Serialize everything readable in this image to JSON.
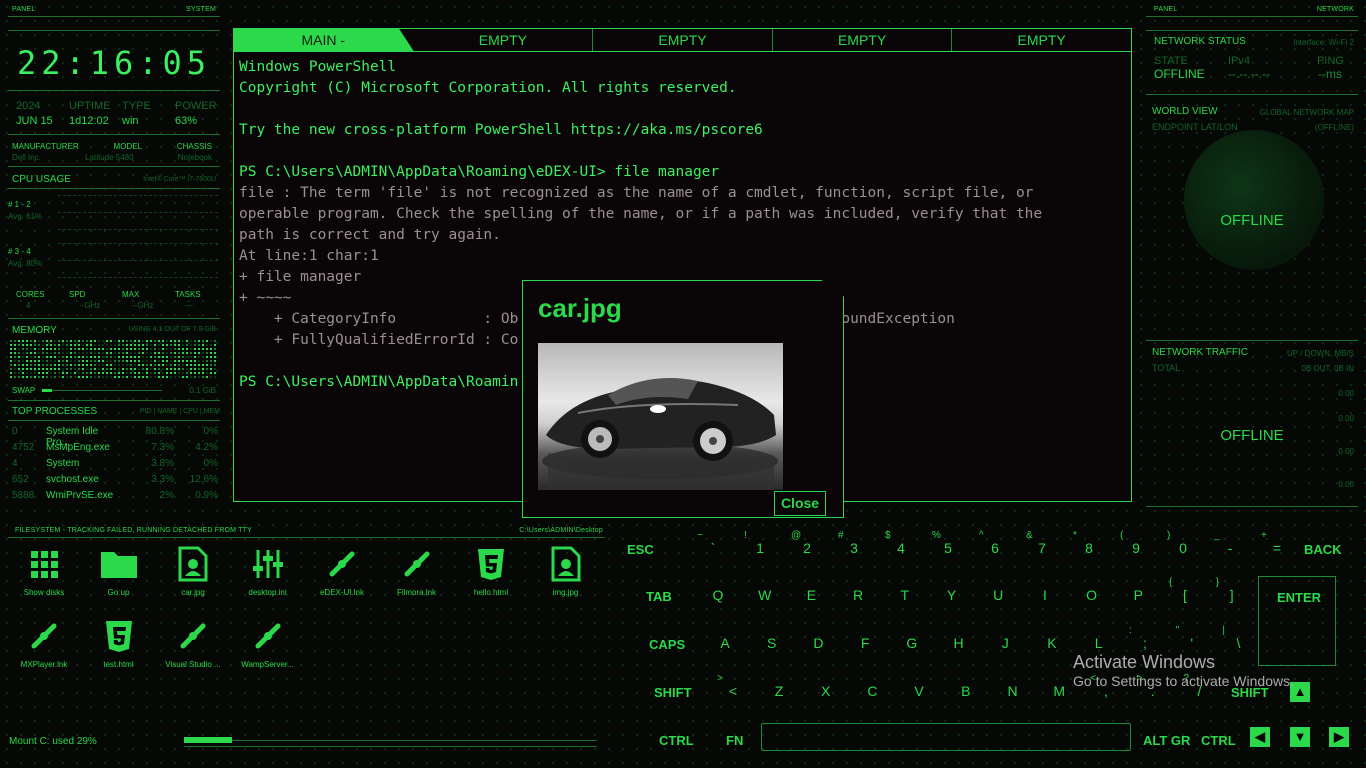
{
  "left_panel": {
    "header_left": "PANEL",
    "header_right": "SYSTEM",
    "clock": "22:16:05",
    "sys_labels": [
      "2024",
      "UPTIME",
      "TYPE",
      "POWER"
    ],
    "sys_values": [
      "JUN 15",
      "1d12:02",
      "win",
      "63%"
    ],
    "hw_labels": [
      "MANUFACTURER",
      "MODEL",
      "CHASSIS"
    ],
    "hw_values": [
      "Dell Inc.",
      "Latitude 5480",
      "Notebook"
    ],
    "cpu_title": "CPU USAGE",
    "cpu_model": "Intel® Core™ i7-7600U",
    "cpu_group1": "# 1 - 2",
    "cpu_group1_avg": "Avg. 61%",
    "cpu_group2": "# 3 - 4",
    "cpu_group2_avg": "Avg. 80%",
    "stat_labels": [
      "CORES",
      "SPD",
      "MAX",
      "TASKS"
    ],
    "stat_values": [
      "4",
      "--GHz",
      "--GHz",
      "---"
    ],
    "memory_title": "MEMORY",
    "memory_info": "USING 4.1 OUT OF 7.9 GiB",
    "swap_label": "SWAP",
    "swap_value": "0.1 GiB",
    "top_title": "TOP PROCESSES",
    "top_cols": "PID | NAME | CPU | MEM",
    "processes": [
      {
        "pid": "0",
        "name": "System Idle Pro...",
        "cpu": "80.8%",
        "mem": "0%"
      },
      {
        "pid": "4752",
        "name": "MsMpEng.exe",
        "cpu": "7.3%",
        "mem": "4.2%"
      },
      {
        "pid": "4",
        "name": "System",
        "cpu": "3.8%",
        "mem": "0%"
      },
      {
        "pid": "652",
        "name": "svchost.exe",
        "cpu": "3.3%",
        "mem": "12.6%"
      },
      {
        "pid": "5888",
        "name": "WmiPrvSE.exe",
        "cpu": "2%",
        "mem": "0.9%"
      }
    ]
  },
  "terminal": {
    "tabs": [
      "MAIN -",
      "EMPTY",
      "EMPTY",
      "EMPTY",
      "EMPTY"
    ],
    "lines": [
      {
        "t": "Windows PowerShell",
        "c": "w"
      },
      {
        "t": "Copyright (C) Microsoft Corporation. All rights reserved.",
        "c": "w"
      },
      {
        "t": "",
        "c": "w"
      },
      {
        "t": "Try the new cross-platform PowerShell https://aka.ms/pscore6",
        "c": "w"
      },
      {
        "t": "",
        "c": "w"
      },
      {
        "t": "PS C:\\Users\\ADMIN\\AppData\\Roaming\\eDEX-UI> file manager",
        "c": "w"
      },
      {
        "t": "file : The term 'file' is not recognized as the name of a cmdlet, function, script file, or",
        "c": "g"
      },
      {
        "t": "operable program. Check the spelling of the name, or if a path was included, verify that the",
        "c": "g"
      },
      {
        "t": "path is correct and try again.",
        "c": "g"
      },
      {
        "t": "At line:1 char:1",
        "c": "g"
      },
      {
        "t": "+ file manager",
        "c": "g"
      },
      {
        "t": "+ ~~~~",
        "c": "g"
      },
      {
        "t": "    + CategoryInfo          : Ob                             mandNotFoundException",
        "c": "g"
      },
      {
        "t": "    + FullyQualifiedErrorId : Co",
        "c": "g"
      },
      {
        "t": "",
        "c": "w"
      },
      {
        "t": "PS C:\\Users\\ADMIN\\AppData\\Roamin",
        "c": "w"
      }
    ]
  },
  "dialog": {
    "title": "car.jpg",
    "close_label": "Close"
  },
  "right_panel": {
    "header_left": "PANEL",
    "header_right": "NETWORK",
    "net_status_title": "NETWORK STATUS",
    "interface": "Interface: Wi-Fi 2",
    "state_label": "STATE",
    "state_value": "OFFLINE",
    "ipv4_label": "IPv4",
    "ipv4_value": "--.--.--.--",
    "ping_label": "PING",
    "ping_value": "--ms",
    "world_title": "WORLD VIEW",
    "world_sub": "GLOBAL NETWORK MAP",
    "endpoint_label": "ENDPOINT LAT/LON",
    "endpoint_value": "(OFFLINE)",
    "world_offline": "OFFLINE",
    "traffic_title": "NETWORK TRAFFIC",
    "traffic_sub": "UP / DOWN, MB/S",
    "total_label": "TOTAL",
    "total_value": "0B OUT, 0B IN",
    "traffic_scale_1": "0.00",
    "traffic_scale_2": "0.00",
    "traffic_scale_3": "0.00",
    "traffic_scale_4": "0.00",
    "traffic_offline": "OFFLINE"
  },
  "filesystem": {
    "header_left": "FILESYSTEM - TRACKING FAILED, RUNNING DETACHED FROM TTY",
    "header_right": "C:\\Users\\ADMIN\\Desktop",
    "items": [
      {
        "label": "Show disks",
        "icon": "grid-icon"
      },
      {
        "label": "Go up",
        "icon": "folder-icon"
      },
      {
        "label": "car.jpg",
        "icon": "image-file-icon"
      },
      {
        "label": "desktop.ini",
        "icon": "settings-file-icon"
      },
      {
        "label": "eDEX-UI.lnk",
        "icon": "link-icon"
      },
      {
        "label": "Filmora.lnk",
        "icon": "link-icon"
      },
      {
        "label": "hello.html",
        "icon": "html5-icon"
      },
      {
        "label": "img.jpg",
        "icon": "image-file-icon"
      },
      {
        "label": "MXPlayer.lnk",
        "icon": "link-icon"
      },
      {
        "label": "test.html",
        "icon": "html5-icon"
      },
      {
        "label": "Visual Studio ...",
        "icon": "link-icon"
      },
      {
        "label": "WampServer...",
        "icon": "link-icon"
      }
    ],
    "mount_label": "Mount C: used 29%",
    "mount_used": 0.29
  },
  "keyboard": {
    "row1": [
      {
        "k": "`",
        "s": "~"
      },
      {
        "k": "1",
        "s": "!"
      },
      {
        "k": "2",
        "s": "@"
      },
      {
        "k": "3",
        "s": "#"
      },
      {
        "k": "4",
        "s": "$"
      },
      {
        "k": "5",
        "s": "%"
      },
      {
        "k": "6",
        "s": "^"
      },
      {
        "k": "7",
        "s": "&"
      },
      {
        "k": "8",
        "s": "*"
      },
      {
        "k": "9",
        "s": "("
      },
      {
        "k": "0",
        "s": ")"
      },
      {
        "k": "-",
        "s": "_"
      },
      {
        "k": "=",
        "s": "+"
      }
    ],
    "row2": [
      "Q",
      "W",
      "E",
      "R",
      "T",
      "Y",
      "U",
      "I",
      "O",
      "P"
    ],
    "row2_extra": [
      {
        "k": "[",
        "s": "{"
      },
      {
        "k": "]",
        "s": "}"
      }
    ],
    "row3": [
      "A",
      "S",
      "D",
      "F",
      "G",
      "H",
      "J",
      "K",
      "L"
    ],
    "row3_extra": [
      {
        "k": ";",
        "s": ":"
      },
      {
        "k": "'",
        "s": "\""
      },
      {
        "k": "\\",
        "s": "|"
      }
    ],
    "row4": [
      "Z",
      "X",
      "C",
      "V",
      "B",
      "N",
      "M"
    ],
    "row4_extra": [
      {
        "k": "<",
        "s": ">"
      },
      {
        "k": ",",
        "s": "<"
      },
      {
        "k": ".",
        "s": ">"
      },
      {
        "k": "/",
        "s": "?"
      }
    ],
    "esc": "ESC",
    "back": "BACK",
    "tab": "TAB",
    "enter": "ENTER",
    "caps": "CAPS",
    "shift_l": "SHIFT",
    "shift_r": "SHIFT",
    "ctrl_l": "CTRL",
    "fn": "FN",
    "altgr": "ALT GR",
    "ctrl_r": "CTRL"
  },
  "watermark": {
    "line1": "Activate Windows",
    "line2": "Go to Settings to activate Windows."
  }
}
